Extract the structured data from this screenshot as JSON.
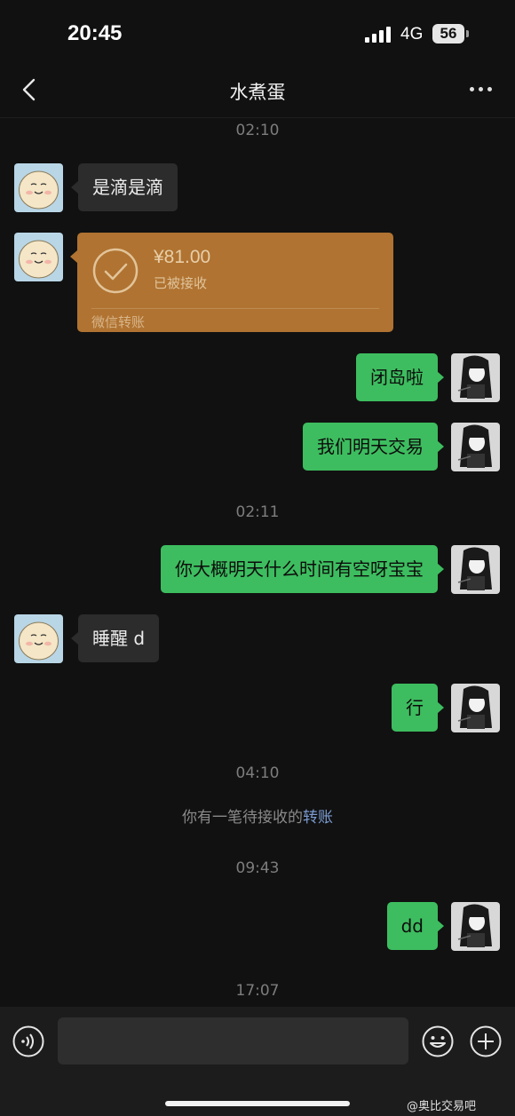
{
  "status": {
    "time": "20:45",
    "network": "4G",
    "battery": "56"
  },
  "nav": {
    "title": "水煮蛋"
  },
  "messages": {
    "ts1": "02:10",
    "m1": "是滴是滴",
    "transfer": {
      "amount": "¥81.00",
      "status": "已被接收",
      "label": "微信转账"
    },
    "m2": "闭岛啦",
    "m3": "我们明天交易",
    "ts2": "02:11",
    "m4": "你大概明天什么时间有空呀宝宝",
    "m5": "睡醒 d",
    "m6": "行",
    "ts3": "04:10",
    "sys_prefix": "你有一笔待接收的",
    "sys_link": "转账",
    "ts4": "09:43",
    "m7": "dd",
    "ts5": "17:07"
  },
  "watermark": "@奥比交易吧",
  "colors": {
    "outgoing": "#3dbd5f",
    "incoming": "#2c2c2c",
    "transfer": "#b07331",
    "background": "#111111"
  }
}
